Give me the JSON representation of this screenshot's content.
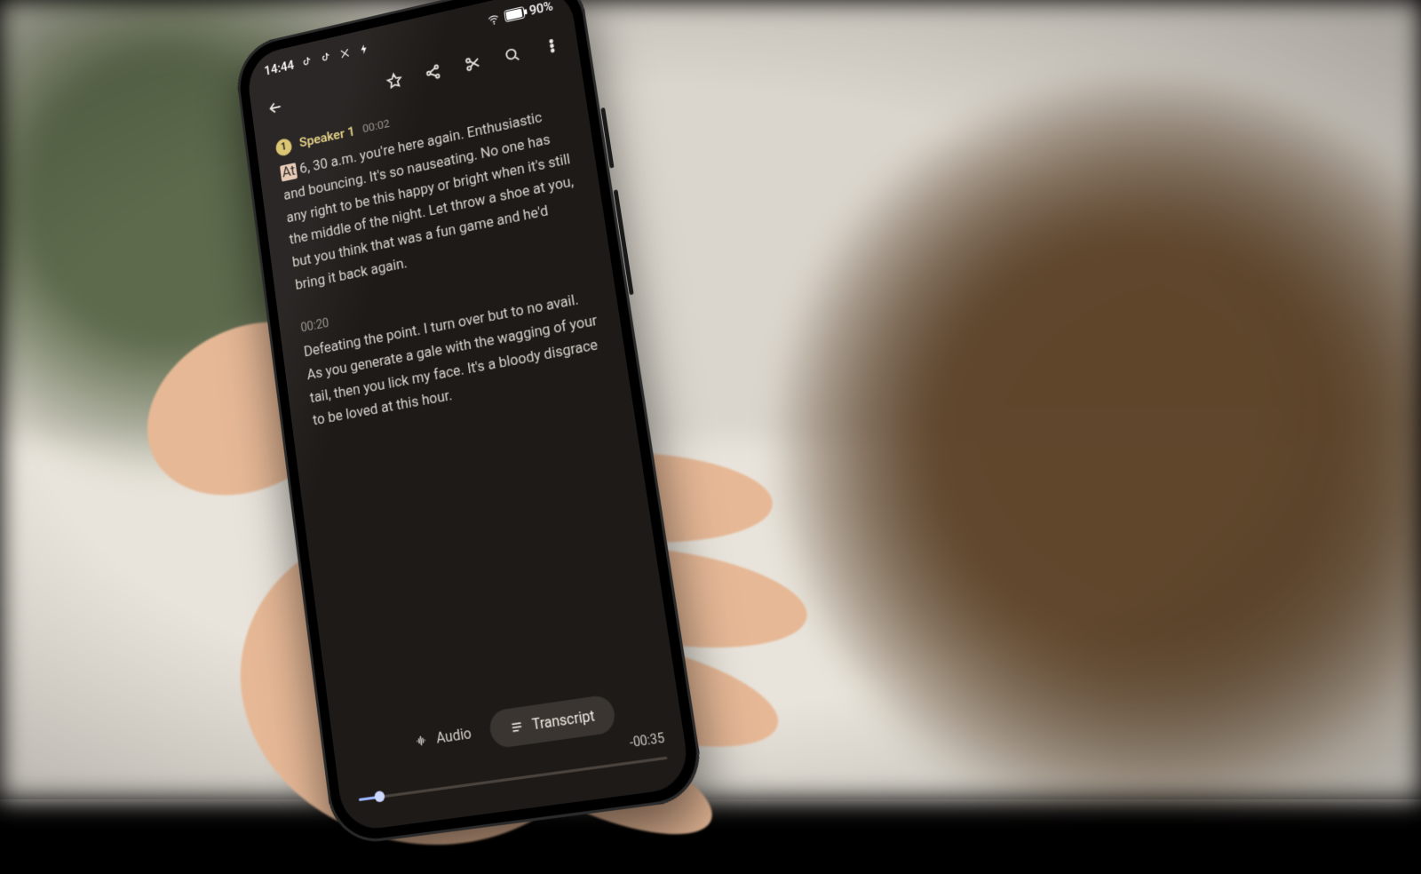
{
  "status_bar": {
    "time": "14:44",
    "battery_text": "90%",
    "icons": [
      "tiktok-icon",
      "tiktok-icon",
      "x-icon",
      "bolt-icon"
    ],
    "right_icons": [
      "wifi-icon",
      "battery-icon"
    ]
  },
  "appbar": {
    "back": "back",
    "actions": [
      "star",
      "share",
      "crop",
      "search",
      "more"
    ]
  },
  "transcript": {
    "segments": [
      {
        "badge": "1",
        "speaker": "Speaker 1",
        "timestamp": "00:02",
        "highlight_word": "At",
        "text_after_highlight": " 6, 30 a.m. you're here again. Enthusiastic and bouncing. It's so nauseating. No one has any right to be this happy or bright when it's still the middle of the night. Let throw a shoe at you, but you think that was a fun game and he'd bring it back again."
      },
      {
        "timestamp": "00:20",
        "text": "Defeating the point. I turn over but to no avail. As you generate a gale with the wagging of your tail, then you lick my face. It's a bloody disgrace to be loved at this hour."
      }
    ]
  },
  "tabs": {
    "audio_label": "Audio",
    "transcript_label": "Transcript",
    "active": "transcript"
  },
  "player": {
    "remaining": "-00:35",
    "progress_pct": 7
  },
  "colors": {
    "screen_bg": "#1e1a18",
    "accent_speaker": "#e3cf82",
    "highlight_bg": "#e6c7b1",
    "scrub_fill": "#9bb4ff"
  }
}
